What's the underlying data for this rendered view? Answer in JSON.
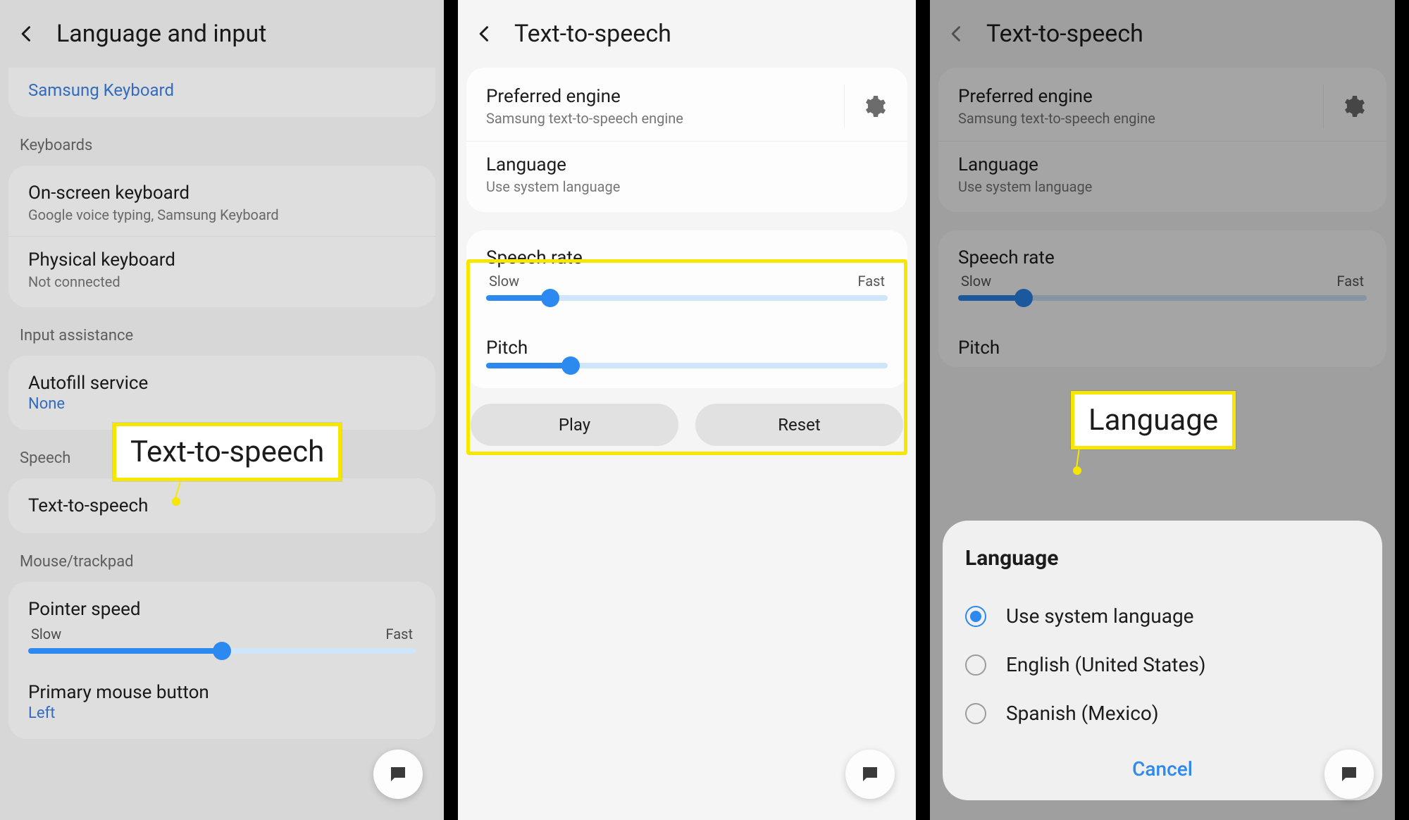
{
  "pane1": {
    "title": "Language and input",
    "top_link": "Samsung Keyboard",
    "keyboards_label": "Keyboards",
    "onscreen": {
      "title": "On-screen keyboard",
      "sub": "Google voice typing, Samsung Keyboard"
    },
    "physical": {
      "title": "Physical keyboard",
      "sub": "Not connected"
    },
    "assist_label": "Input assistance",
    "autofill": {
      "title": "Autofill service",
      "val": "None"
    },
    "speech_label": "Speech",
    "tts": {
      "title": "Text-to-speech"
    },
    "mouse_label": "Mouse/trackpad",
    "pointer": {
      "title": "Pointer speed",
      "slow": "Slow",
      "fast": "Fast",
      "percent": 50
    },
    "primary": {
      "title": "Primary mouse button",
      "val": "Left"
    },
    "callout": "Text-to-speech"
  },
  "pane2": {
    "title": "Text-to-speech",
    "engine": {
      "title": "Preferred engine",
      "sub": "Samsung text-to-speech engine"
    },
    "lang": {
      "title": "Language",
      "sub": "Use system language"
    },
    "rate": {
      "title": "Speech rate",
      "slow": "Slow",
      "fast": "Fast",
      "percent": 16
    },
    "pitch": {
      "title": "Pitch",
      "percent": 21
    },
    "play": "Play",
    "reset": "Reset"
  },
  "pane3": {
    "title": "Text-to-speech",
    "engine": {
      "title": "Preferred engine",
      "sub": "Samsung text-to-speech engine"
    },
    "lang": {
      "title": "Language",
      "sub": "Use system language"
    },
    "rate": {
      "title": "Speech rate",
      "slow": "Slow",
      "fast": "Fast",
      "percent": 16
    },
    "pitch": {
      "title": "Pitch"
    },
    "sheet": {
      "title": "Language",
      "opts": [
        "Use system language",
        "English (United States)",
        "Spanish (Mexico)"
      ],
      "selected": 0,
      "cancel": "Cancel"
    },
    "callout": "Language"
  }
}
